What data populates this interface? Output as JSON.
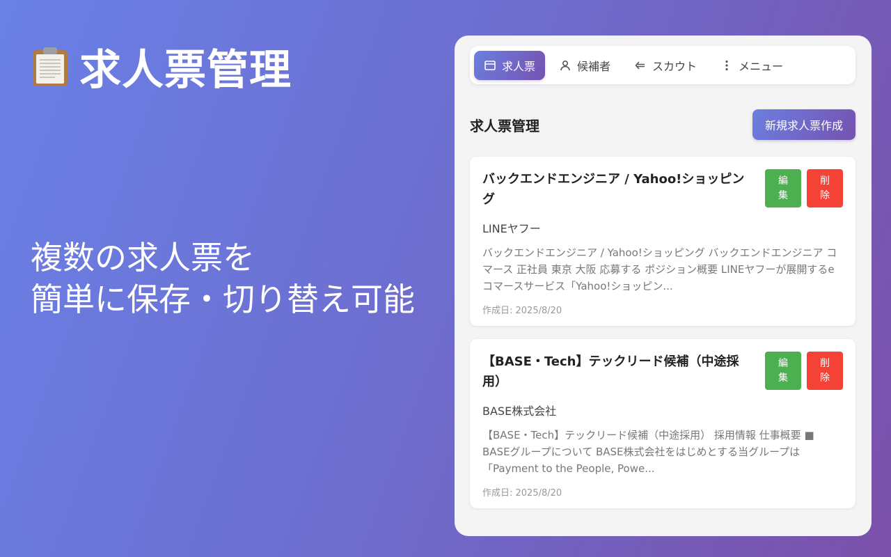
{
  "hero": {
    "title": "求人票管理",
    "subtitle_lines": [
      "複数の求人票を",
      "簡単に保存・切り替え可能"
    ]
  },
  "tabs": [
    {
      "label": "求人票",
      "icon": "window-icon",
      "active": true
    },
    {
      "label": "候補者",
      "icon": "person-icon",
      "active": false
    },
    {
      "label": "スカウト",
      "icon": "arrow-left-icon",
      "active": false
    },
    {
      "label": "メニュー",
      "icon": "more-vertical-icon",
      "active": false
    }
  ],
  "section": {
    "title": "求人票管理",
    "new_button": "新規求人票作成"
  },
  "cards": [
    {
      "title": "バックエンドエンジニア / Yahoo!ショッピング",
      "company": "LINEヤフー",
      "description": "バックエンドエンジニア / Yahoo!ショッピング バックエンドエンジニア コマース 正社員 東京 大阪 応募する ポジション概要 LINEヤフーが展開するeコマースサービス「Yahoo!ショッピン...",
      "date": "作成日: 2025/8/20",
      "edit_label": [
        "編",
        "集"
      ],
      "delete_label": [
        "削",
        "除"
      ]
    },
    {
      "title": "【BASE・Tech】テックリード候補（中途採用）",
      "company": "BASE株式会社",
      "description": "【BASE・Tech】テックリード候補（中途採用） 採用情報 仕事概要 ■ BASEグループについて BASE株式会社をはじめとする当グループは「Payment to the People, Powe...",
      "date": "作成日: 2025/8/20",
      "edit_label": [
        "編",
        "集"
      ],
      "delete_label": [
        "削",
        "除"
      ]
    }
  ],
  "colors": {
    "accent_start": "#6b7fe0",
    "accent_end": "#7652b0",
    "edit": "#4caf50",
    "delete": "#f44336"
  }
}
